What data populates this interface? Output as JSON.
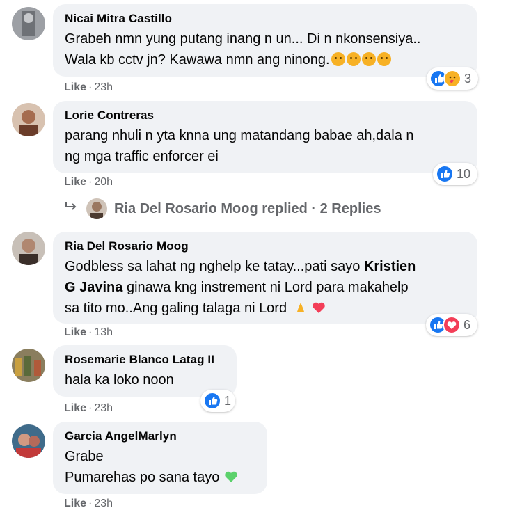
{
  "comments": [
    {
      "author": "Nicai Mitra Castillo",
      "line1": "Grabeh nmn yung putang inang n un... Di n nkonsensiya..",
      "line2": "Wala kb cctv jn? Kawawa nmn ang ninong.",
      "like_label": "Like",
      "time": "23h",
      "reaction_count": "3",
      "avatar_color": "#b0b3b8"
    },
    {
      "author": "Lorie Contreras",
      "line1": "parang nhuli n yta knna ung matandang babae ah,dala n",
      "line2": "ng mga traffic enforcer ei",
      "like_label": "Like",
      "time": "20h",
      "reaction_count": "10",
      "avatar_color": "#c9a48a"
    },
    {
      "author": "Ria Del Rosario Moog",
      "line1_pre": "Godbless sa lahat ng nghelp ke tatay...pati sayo ",
      "mention1": "Kristien",
      "mention2": "G Javina",
      "line2_post": " ginawa kng instrement ni Lord para makahelp",
      "line3": "sa tito mo..Ang galing talaga ni Lord",
      "like_label": "Like",
      "time": "13h",
      "reaction_count": "6",
      "avatar_color": "#8a7a70"
    },
    {
      "author": "Rosemarie Blanco Latag II",
      "line1": "hala ka loko noon",
      "like_label": "Like",
      "time": "23h",
      "reaction_count": "1",
      "avatar_color": "#7a6f55"
    },
    {
      "author": "Garcia AngelMarlyn",
      "line1": "Grabe",
      "line2": "Pumarehas po sana tayo",
      "like_label": "Like",
      "time": "23h",
      "avatar_color": "#b56a5a"
    }
  ],
  "replied": {
    "author": "Ria Del Rosario Moog",
    "text": "replied",
    "count_text": "2 Replies"
  },
  "colors": {
    "bubble": "#f0f2f5",
    "meta_text": "#65676b",
    "like_blue": "#1877f2",
    "heart_red": "#f33e58",
    "care_yellow": "#f7b125",
    "green_heart": "#5bd16b"
  },
  "icons": {
    "reply_arrow": "reply-arrow-icon",
    "like": "like-reaction-icon",
    "heart": "heart-reaction-icon",
    "care": "care-reaction-icon"
  }
}
